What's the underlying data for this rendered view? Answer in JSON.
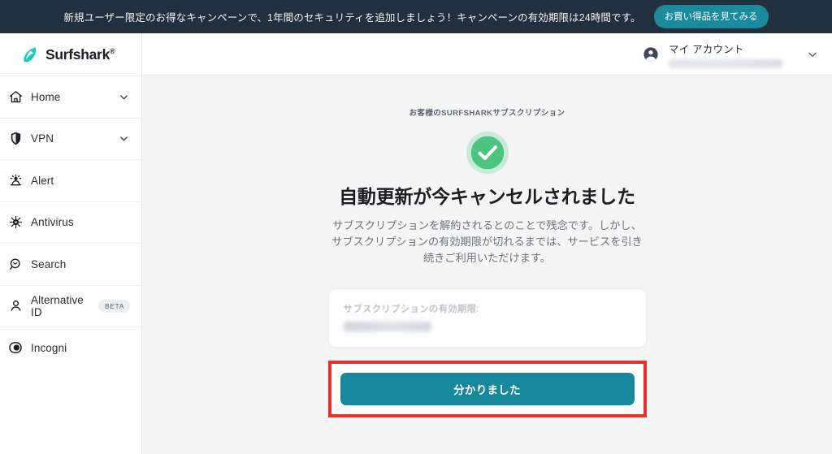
{
  "promo_banner": {
    "message": "新規ユーザー限定のお得なキャンペーンで、1年間のセキュリティを追加しましょう！キャンペーンの有効期限は24時間です。",
    "cta_label": "お買い得品を見てみる",
    "background_color": "#222f3e",
    "cta_color": "#1b8a9c"
  },
  "sidebar": {
    "brand": {
      "name": "Surfshark",
      "trademark": "®",
      "logo_color": "#1ecdb0"
    },
    "items": [
      {
        "label": "Home",
        "icon": "home-icon",
        "expandable": true
      },
      {
        "label": "VPN",
        "icon": "shield-icon",
        "expandable": true
      },
      {
        "label": "Alert",
        "icon": "alert-icon",
        "expandable": false
      },
      {
        "label": "Antivirus",
        "icon": "bug-icon",
        "expandable": false
      },
      {
        "label": "Search",
        "icon": "search-icon",
        "expandable": false
      },
      {
        "label": "Alternative ID",
        "icon": "person-icon",
        "badge": "BETA",
        "expandable": false
      },
      {
        "label": "Incogni",
        "icon": "toggle-icon",
        "expandable": false
      }
    ]
  },
  "topbar": {
    "account_label": "マイ アカウント",
    "account_email_redacted": true,
    "chevron": "chevron-down-icon"
  },
  "main": {
    "eyebrow": "お客様のSURFSHARKサブスクリプション",
    "status_icon": "success-check-icon",
    "status_icon_color": "#4cc37e",
    "headline": "自動更新が今キャンセルされました",
    "body": "サブスクリプションを解約されるとのことで残念です。しかし、サブスクリプションの有効期限が切れるまでは、サービスを引き続きご利用いただけます。",
    "info_card": {
      "label": "サブスクリプションの有効期限:",
      "value_redacted": true
    },
    "primary_button": {
      "label": "分かりました",
      "color": "#17879b"
    },
    "highlight": {
      "color": "#e8312a",
      "target": "primary-button"
    }
  }
}
